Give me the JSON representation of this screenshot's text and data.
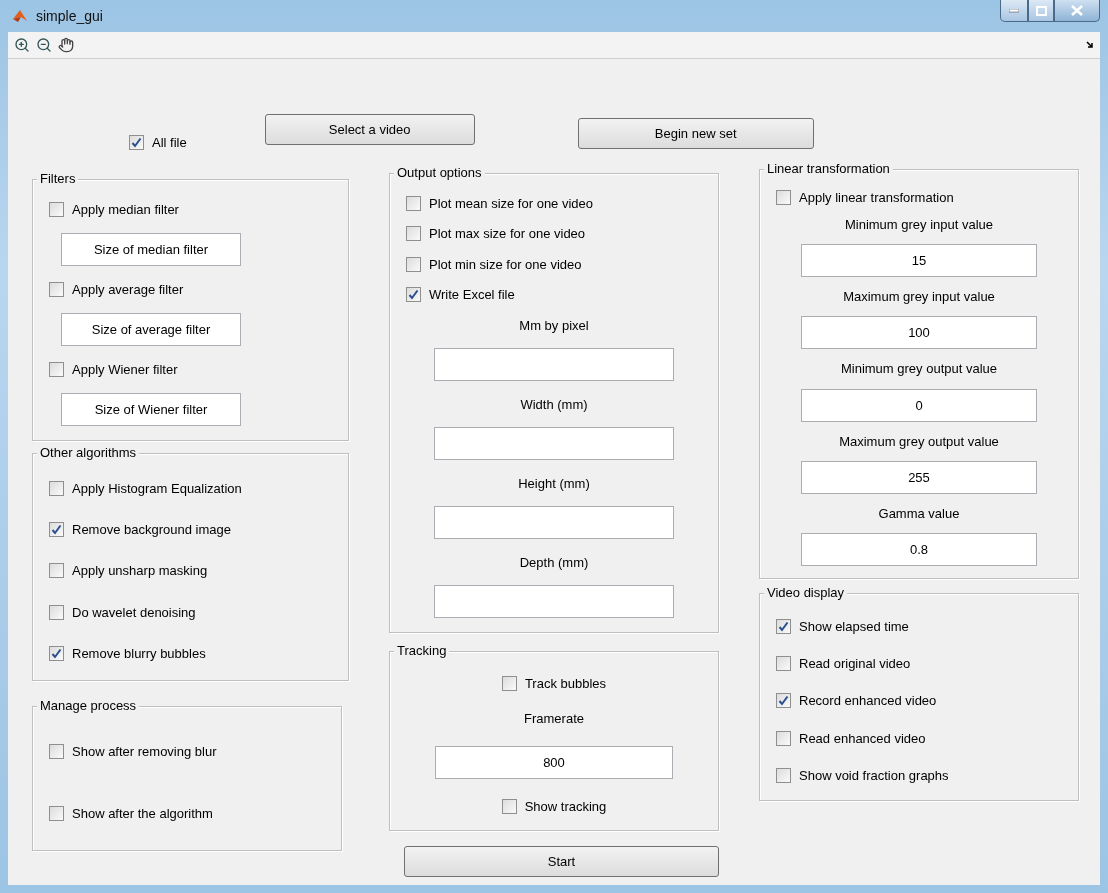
{
  "window": {
    "title": "simple_gui"
  },
  "all_file": {
    "label": "All file",
    "checked": true
  },
  "top_buttons": [
    "Select a video",
    "Begin new set"
  ],
  "filters": {
    "title": "Filters",
    "items": [
      {
        "kind": "checkbox",
        "label": "Apply median filter",
        "checked": false
      },
      {
        "kind": "field",
        "value": "Size of median filter"
      },
      {
        "kind": "checkbox",
        "label": "Apply average filter",
        "checked": false
      },
      {
        "kind": "field",
        "value": "Size of average filter"
      },
      {
        "kind": "checkbox",
        "label": "Apply Wiener filter",
        "checked": false
      },
      {
        "kind": "field",
        "value": "Size of Wiener filter"
      }
    ]
  },
  "other_algorithms": {
    "title": "Other algorithms",
    "items": [
      {
        "kind": "checkbox",
        "label": "Apply Histogram Equalization",
        "checked": false
      },
      {
        "kind": "checkbox",
        "label": "Remove background image",
        "checked": true
      },
      {
        "kind": "checkbox",
        "label": "Apply unsharp masking",
        "checked": false
      },
      {
        "kind": "checkbox",
        "label": "Do wavelet denoising",
        "checked": false
      },
      {
        "kind": "checkbox",
        "label": "Remove blurry bubbles",
        "checked": true
      }
    ]
  },
  "manage_process": {
    "title": "Manage process",
    "items": [
      {
        "kind": "checkbox",
        "label": "Show after removing blur",
        "checked": false
      },
      {
        "kind": "checkbox",
        "label": "Show after the algorithm",
        "checked": false
      }
    ]
  },
  "output_options": {
    "title": "Output options",
    "items": [
      {
        "kind": "checkbox",
        "label": "Plot mean size for one video",
        "checked": false
      },
      {
        "kind": "checkbox",
        "label": "Plot max size for one video",
        "checked": false
      },
      {
        "kind": "checkbox",
        "label": "Plot min size for one video",
        "checked": false
      },
      {
        "kind": "checkbox",
        "label": "Write Excel file",
        "checked": true
      },
      {
        "kind": "label",
        "text": "Mm by pixel"
      },
      {
        "kind": "field"
      },
      {
        "kind": "label",
        "text": "Width (mm)"
      },
      {
        "kind": "field"
      },
      {
        "kind": "label",
        "text": "Height (mm)"
      },
      {
        "kind": "field"
      },
      {
        "kind": "label",
        "text": "Depth (mm)"
      },
      {
        "kind": "field"
      }
    ]
  },
  "tracking": {
    "title": "Tracking",
    "items": [
      {
        "kind": "checkbox",
        "label": "Track bubbles",
        "checked": false
      },
      {
        "kind": "label",
        "text": "Framerate"
      },
      {
        "kind": "field",
        "value": "800"
      },
      {
        "kind": "checkbox",
        "label": "Show tracking",
        "checked": false
      }
    ]
  },
  "start_button": "Start",
  "linear_transformation": {
    "title": "Linear transformation",
    "items": [
      {
        "kind": "checkbox",
        "label": "Apply linear transformation",
        "checked": false
      },
      {
        "kind": "label",
        "text": "Minimum grey input value"
      },
      {
        "kind": "field",
        "value": "15"
      },
      {
        "kind": "label",
        "text": "Maximum grey input value"
      },
      {
        "kind": "field",
        "value": "100"
      },
      {
        "kind": "label",
        "text": "Minimum grey output value"
      },
      {
        "kind": "field",
        "value": "0"
      },
      {
        "kind": "label",
        "text": "Maximum grey output value"
      },
      {
        "kind": "field",
        "value": "255"
      },
      {
        "kind": "label",
        "text": "Gamma value"
      },
      {
        "kind": "field",
        "value": "0.8"
      }
    ]
  },
  "video_display": {
    "title": "Video display",
    "items": [
      {
        "kind": "checkbox",
        "label": "Show elapsed time",
        "checked": true
      },
      {
        "kind": "checkbox",
        "label": "Read original video",
        "checked": false
      },
      {
        "kind": "checkbox",
        "label": "Record enhanced video",
        "checked": true
      },
      {
        "kind": "checkbox",
        "label": "Read enhanced video",
        "checked": false
      },
      {
        "kind": "checkbox",
        "label": "Show void fraction graphs",
        "checked": false
      }
    ]
  }
}
